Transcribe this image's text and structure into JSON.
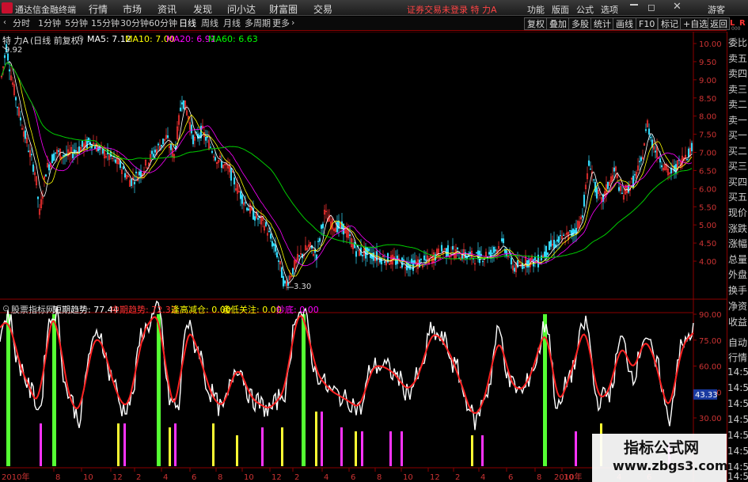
{
  "app": {
    "name": "通达信金融终端",
    "menu": [
      "行情",
      "市场",
      "资讯",
      "发现",
      "问小达",
      "财富圈",
      "交易"
    ],
    "status": "证券交易未登录  特 力A",
    "right_menu": [
      "功能",
      "版面",
      "公式",
      "选项"
    ],
    "guest": "游客"
  },
  "toolbar": {
    "periods": [
      "分时",
      "1分钟",
      "5分钟",
      "15分钟",
      "30分钟",
      "60分钟",
      "日线",
      "周线",
      "月线",
      "多周期",
      "更多"
    ],
    "active_period": "日线",
    "buttons": [
      "复权",
      "叠加",
      "多股",
      "统计",
      "画线",
      "F10",
      "标记",
      "+自选",
      "返回"
    ]
  },
  "main_chart": {
    "stock": "特 力A",
    "adjust": "(日线 前复权)",
    "ma": [
      {
        "label": "MA5: 7.12",
        "color": "#ffffff"
      },
      {
        "label": "MA10: 7.00",
        "color": "#ffff00"
      },
      {
        "label": "MA20: 6.91",
        "color": "#ff00ff"
      },
      {
        "label": "MA60: 6.63",
        "color": "#00ff00"
      }
    ],
    "high_label": "9.92",
    "low_label": "3.30",
    "y_ticks": [
      "10.00",
      "9.50",
      "9.00",
      "8.50",
      "8.00",
      "7.50",
      "7.00",
      "6.50",
      "6.00",
      "5.50",
      "5.00",
      "4.50",
      "4.00"
    ],
    "corner_labels": [
      "L",
      "R"
    ],
    "corner_sub": "000"
  },
  "indicator": {
    "name": "股票指标网",
    "short_trend": "短期趋势: 77.44",
    "mid_trend": "中期趋势: 72.32",
    "sig1": "逢高减仓: 0.00",
    "sig2": "逢低关注: 0.00",
    "sig3": "抄底: 0.00",
    "y_ticks": [
      "90.00",
      "75.00",
      "60.00",
      "45.00",
      "30.00"
    ],
    "current_value": "43.33"
  },
  "x_axis": {
    "year_start": "2010年",
    "labels": [
      "8",
      "10",
      "12",
      "2",
      "4",
      "6",
      "8",
      "10",
      "12",
      "2",
      "4",
      "6",
      "8",
      "10",
      "12",
      "2",
      "4",
      "6",
      "8",
      "10",
      "2010年",
      "4",
      "6"
    ]
  },
  "sidebar": [
    "委比",
    "卖五",
    "卖四",
    "卖三",
    "卖二",
    "卖一",
    "买一",
    "买二",
    "买三",
    "买四",
    "买五",
    "现价",
    "涨跌",
    "涨幅",
    "总量",
    "外盘",
    "换手",
    "净资",
    "收益",
    "自动",
    "行情",
    "14:5",
    "14:5",
    "14:5",
    "14:5",
    "14:5",
    "14:5",
    "14:5",
    "14:5"
  ],
  "watermark": {
    "title": "指标公式网",
    "url": "www.zbgs3.com"
  }
}
